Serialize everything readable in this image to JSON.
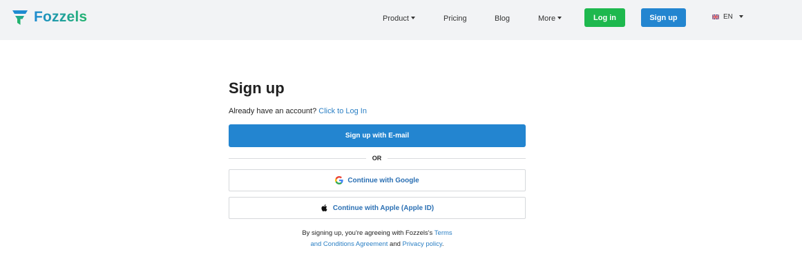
{
  "header": {
    "brand": "Fozzels",
    "nav": {
      "product": "Product",
      "pricing": "Pricing",
      "blog": "Blog",
      "more": "More"
    },
    "login_label": "Log in",
    "signup_label": "Sign up",
    "language": "EN"
  },
  "signup": {
    "title": "Sign up",
    "have_account_text": "Already have an account?",
    "login_link": "Click to Log In",
    "email_button": "Sign up with E-mail",
    "or_label": "OR",
    "google_button": "Continue with Google",
    "apple_button": "Continue with Apple (Apple ID)",
    "legal": {
      "prefix": "By signing up, you're agreeing with Fozzels's",
      "terms_link_line1": "Terms",
      "terms_link_line2": "and Conditions Agreement",
      "and": "and",
      "privacy_link": "Privacy policy",
      "suffix": "."
    }
  },
  "colors": {
    "brand_blue": "#2385d0",
    "brand_green": "#1eb84e",
    "link": "#2a7fc4",
    "header_bg": "#f2f3f5"
  },
  "icons": {
    "logo": "fozzels-logo-icon",
    "google": "google-icon",
    "apple": "apple-icon",
    "flag": "uk-flag-icon"
  }
}
